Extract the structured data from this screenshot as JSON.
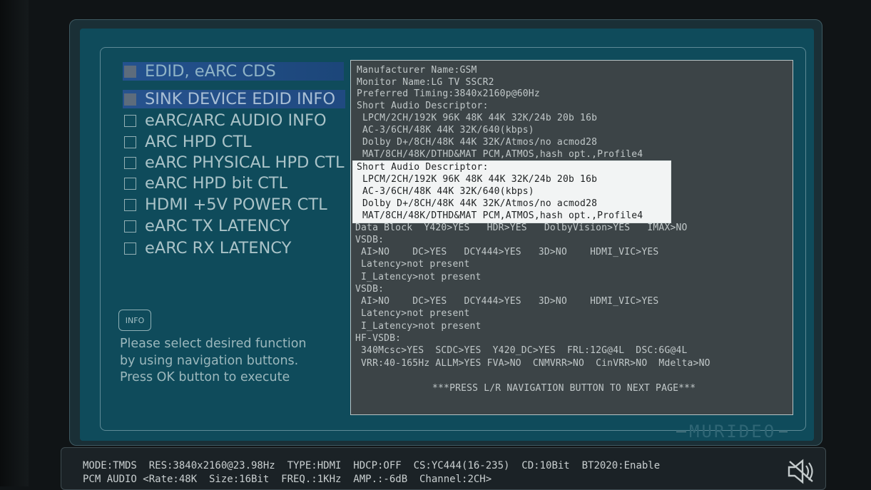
{
  "menu": {
    "header": "EDID, eARC CDS",
    "items": [
      {
        "label": "SINK DEVICE EDID INFO",
        "selected": true
      },
      {
        "label": "eARC/ARC AUDIO INFO"
      },
      {
        "label": "ARC HPD CTL"
      },
      {
        "label": "eARC PHYSICAL HPD CTL"
      },
      {
        "label": "eARC HPD bit CTL"
      },
      {
        "label": "HDMI +5V POWER CTL"
      },
      {
        "label": "eARC TX LATENCY"
      },
      {
        "label": "eARC RX LATENCY"
      }
    ]
  },
  "info": {
    "icon_label": "INFO",
    "lines": [
      "Please select desired function",
      "by using navigation buttons.",
      "Press OK button to execute"
    ]
  },
  "edid": {
    "lines": [
      "Manufacturer Name:GSM",
      "Monitor Name:LG TV SSCR2",
      "Preferred Timing:3840x2160p@60Hz",
      "Short Audio Descriptor:",
      " LPCM/2CH/192K 96K 48K 44K 32K/24b 20b 16b",
      " AC-3/6CH/48K 44K 32K/640(kbps)",
      " Dolby D+/8CH/48K 44K 32K/Atmos/no acmod28",
      " MAT/8CH/48K/DTHD&MAT PCM,ATMOS,hash opt.,Profile4"
    ],
    "highlight_lines": [
      "Short Audio Descriptor:",
      " LPCM/2CH/192K 96K 48K 44K 32K/24b 20b 16b",
      " AC-3/6CH/48K 44K 32K/640(kbps)",
      " Dolby D+/8CH/48K 44K 32K/Atmos/no acmod28",
      " MAT/8CH/48K/DTHD&MAT PCM,ATMOS,hash opt.,Profile4"
    ],
    "lines_after": [
      "Data Block  Y420>YES   HDR>YES   DolbyVision>YES   IMAX>NO",
      "VSDB:",
      " AI>NO    DC>YES   DCY444>YES   3D>NO    HDMI_VIC>YES",
      " Latency>not present",
      " I_Latency>not present",
      "VSDB:",
      " AI>NO    DC>YES   DCY444>YES   3D>NO    HDMI_VIC>YES",
      " Latency>not present",
      " I_Latency>not present",
      "HF-VSDB:",
      " 340Mcsc>YES  SCDC>YES  Y420_DC>YES  FRL:12G@4L  DSC:6G@4L",
      " VRR:40-165Hz ALLM>YES FVA>NO  CNMVRR>NO  CinVRR>NO  Mdelta>NO"
    ],
    "footer": "***PRESS L/R NAVIGATION BUTTON TO NEXT PAGE***"
  },
  "brand": "MURIDEO",
  "status": {
    "line1": "MODE:TMDS  RES:3840x2160@23.98Hz  TYPE:HDMI  HDCP:OFF  CS:YC444(16-235)  CD:10Bit  BT2020:Enable",
    "line2": "PCM AUDIO <Rate:48K  Size:16Bit  FREQ.:1KHz  AMP.:-6dB  Channel:2CH>"
  },
  "icons": {
    "mute": "speaker-mute-icon",
    "info": "info-icon"
  }
}
